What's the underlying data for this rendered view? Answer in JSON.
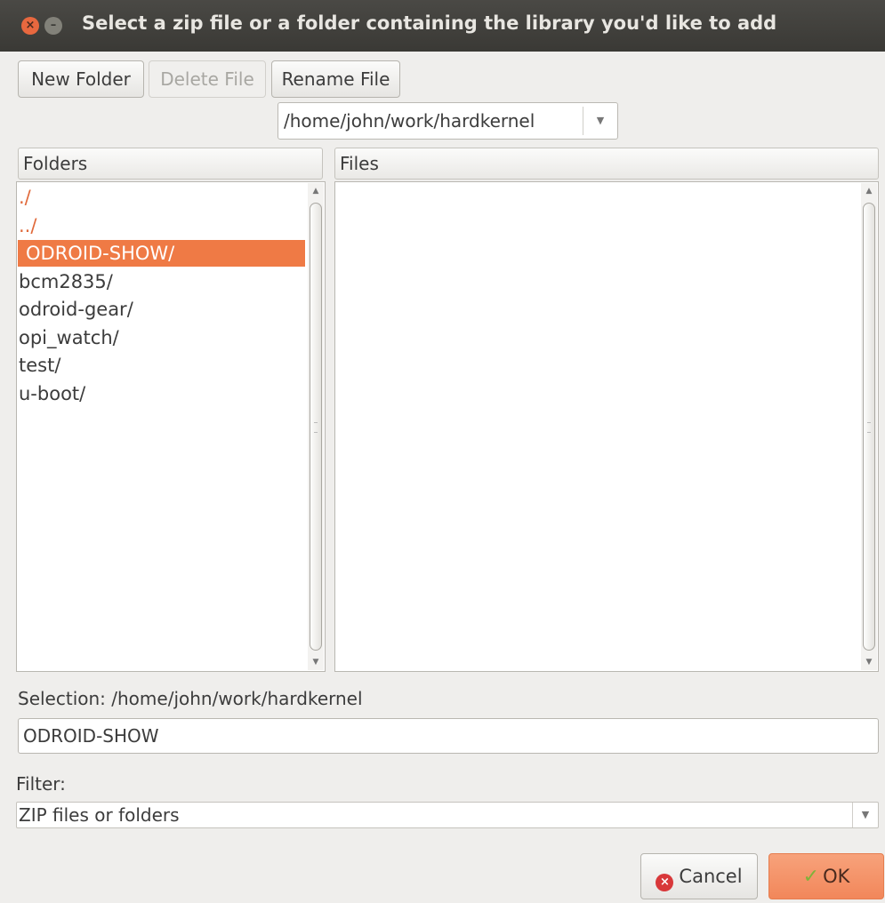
{
  "window": {
    "title": "Select a zip file or a folder containing the library you'd like to add"
  },
  "toolbar": {
    "new_folder": "New Folder",
    "delete_file": "Delete File",
    "rename_file": "Rename File"
  },
  "path_combo": {
    "value": "/home/john/work/hardkernel"
  },
  "folders": {
    "header": "Folders",
    "items": [
      "./",
      "../",
      "ODROID-SHOW/",
      "bcm2835/",
      "odroid-gear/",
      "opi_watch/",
      "test/",
      "u-boot/"
    ],
    "selected": "ODROID-SHOW/"
  },
  "files": {
    "header": "Files",
    "items": []
  },
  "selection": {
    "label": "Selection: /home/john/work/hardkernel",
    "value": "ODROID-SHOW"
  },
  "filter": {
    "label": "Filter:",
    "value": "ZIP files or folders"
  },
  "buttons": {
    "cancel": "Cancel",
    "ok": "OK"
  },
  "colors": {
    "accent": "#ef7a45",
    "titlebar": "#3c3b37",
    "close": "#e8683f"
  }
}
